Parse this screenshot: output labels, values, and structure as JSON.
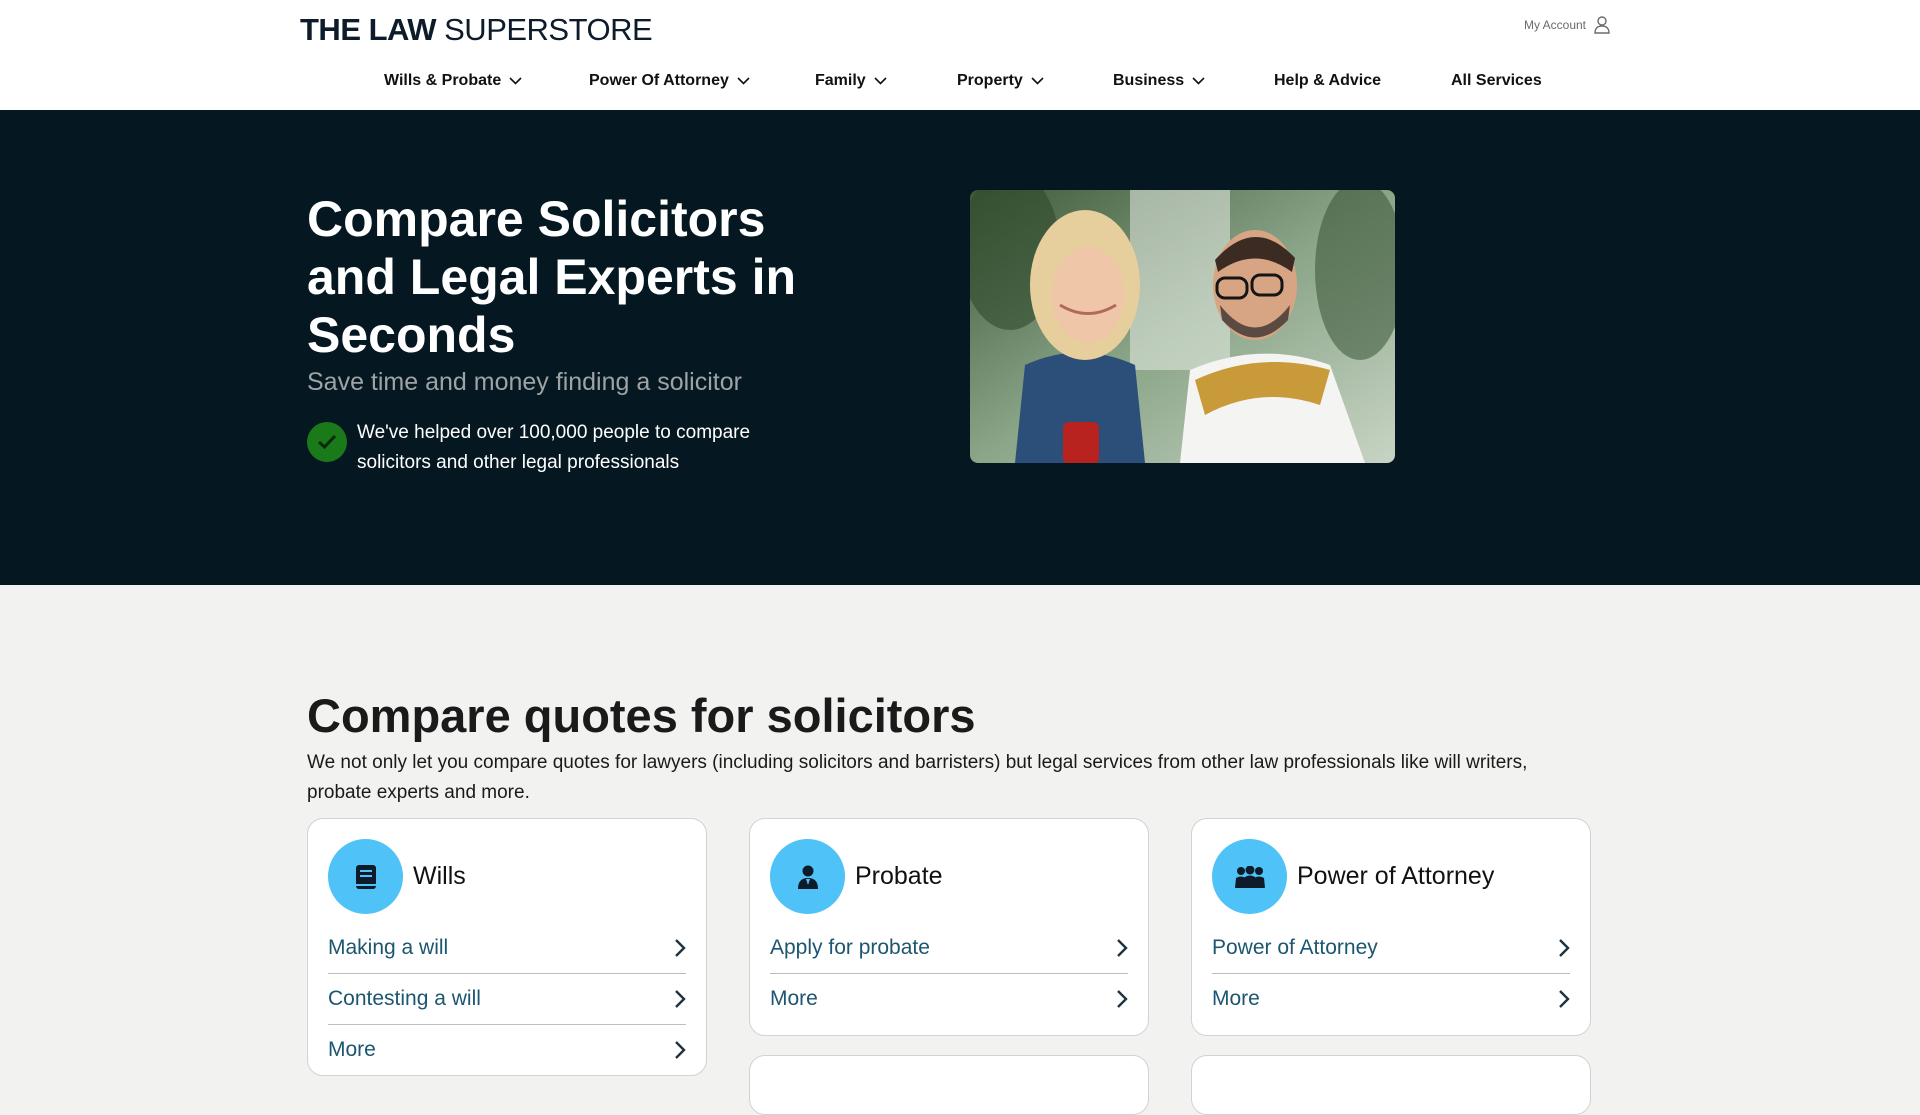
{
  "header": {
    "logo_bold": "THE LAW",
    "logo_rest": "SUPERSTORE",
    "account_label": "My Account",
    "account_icon": "user-icon"
  },
  "nav": {
    "items": [
      {
        "label": "Wills & Probate",
        "has_dropdown": true
      },
      {
        "label": "Power Of Attorney",
        "has_dropdown": true
      },
      {
        "label": "Family",
        "has_dropdown": true
      },
      {
        "label": "Property",
        "has_dropdown": true
      },
      {
        "label": "Business",
        "has_dropdown": true
      },
      {
        "label": "Help & Advice",
        "has_dropdown": false
      },
      {
        "label": "All Services",
        "has_dropdown": false
      }
    ]
  },
  "hero": {
    "title": "Compare Solicitors and Legal Experts in Seconds",
    "subtitle": "Save time and money finding a solicitor",
    "check_text": "We've helped over 100,000 people to compare solicitors and other legal professionals",
    "check_icon": "checkmark-icon",
    "image_icon": "couple-with-phone-photo"
  },
  "compare": {
    "title": "Compare quotes for solicitors",
    "text": "We not only let you compare quotes for lawyers (including solicitors and barristers) but legal services from other law professionals like will writers, probate experts and more."
  },
  "cards": [
    {
      "title": "Wills",
      "icon": "book-icon",
      "links": [
        "Making a will",
        "Contesting a will",
        "More"
      ]
    },
    {
      "title": "Probate",
      "icon": "person-icon",
      "links": [
        "Apply for probate",
        "More"
      ]
    },
    {
      "title": "Power of Attorney",
      "icon": "group-icon",
      "links": [
        "Power of Attorney",
        "More"
      ]
    }
  ],
  "colors": {
    "hero_bg": "#051821",
    "accent_icon_bg": "#4fc3f7",
    "link": "#1c5670",
    "check_green": "#1a7a1a"
  }
}
